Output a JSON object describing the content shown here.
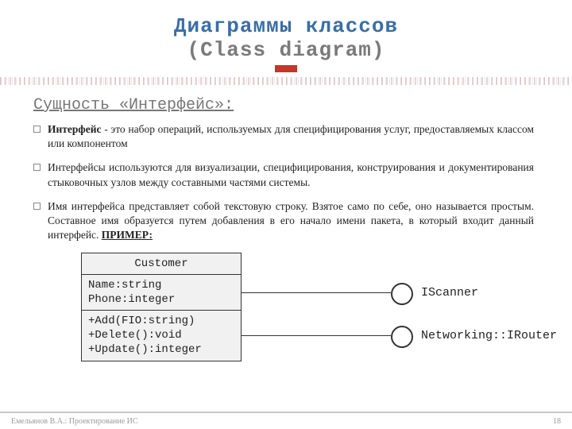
{
  "header": {
    "title_main": "Диаграммы классов",
    "title_sub": "(Class diagram)"
  },
  "section": {
    "title": "Сущность «Интерфейс»",
    "colon": ":"
  },
  "bullets": [
    {
      "lead_bold": "Интерфейс",
      "rest": " - это набор операций, используемых для специфицирования услуг, предоставляемых классом или компонентом",
      "primer": ""
    },
    {
      "lead_bold": "",
      "rest": "Интерфейсы используются для визуализации, специфицирования, конструирования и документирования стыковочных узлов между составными частями системы.",
      "primer": ""
    },
    {
      "lead_bold": "",
      "rest": "Имя интерфейса представляет собой текстовую строку. Взятое само по себе, оно называется простым. Составное имя образуется путем добавления в его начало имени пакета, в который входит данный интерфейс. ",
      "primer": "ПРИМЕР:"
    }
  ],
  "class_diagram": {
    "name": "Customer",
    "attr1": "Name:string",
    "attr2": "Phone:integer",
    "op1": "+Add(FIO:string)",
    "op2": "+Delete():void",
    "op3": "+Update():integer",
    "iface1": "IScanner",
    "iface2": "Networking::IRouter"
  },
  "footer": {
    "left": "Емельянов В.А.: Проектирование ИС",
    "page": "18"
  }
}
